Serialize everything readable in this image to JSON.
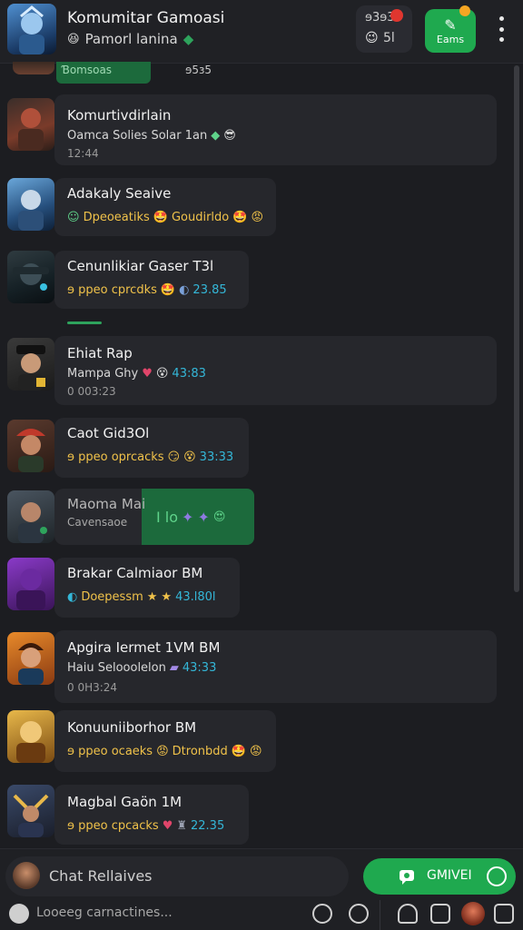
{
  "header": {
    "title": "Komumitar Gamoasi",
    "subtitle": "Pamorl lanina",
    "badge_top": "ɘ3ɘ3",
    "badge_bottom": "5l",
    "games_label": "Eams"
  },
  "partial_row": {
    "text": "Ɓomsoas",
    "text2": "ɘ5ɜ5"
  },
  "chats": [
    {
      "name": "Komurtivdirlain",
      "message": "Oamca Solies Solar 1an",
      "time": "12:44",
      "color": "w"
    },
    {
      "name": "Adakaly Seaive",
      "message": "Dpeoeatiks",
      "message2": "Goudirldo",
      "color": "y"
    },
    {
      "name": "Cenunlikiar Gaser T3l",
      "message": "ɘ ppeo cprcdks",
      "time": "23.85",
      "color": "y"
    },
    {
      "name": "Ehiat Rap",
      "message": "Mampa Ghy",
      "time": "43:83",
      "meta": "0 003:23",
      "color": "w"
    },
    {
      "name": "Caot Gid3Ol",
      "message": "ɘ ppeo oprcacks",
      "time": "33:33",
      "color": "y"
    },
    {
      "name": "Maoma Mai",
      "message": "Cavensaoe",
      "extra": "I lo",
      "color": "w"
    },
    {
      "name": "Brakar Calmiaor BM",
      "message": "Doepessm",
      "time": "43.l80l",
      "color": "y"
    },
    {
      "name": "Apgira Iermet 1VM BM",
      "message": "Haiu Selooolelon",
      "time": "43:33",
      "meta": "0 0H3:24",
      "color": "w"
    },
    {
      "name": "Konuuniiborhor BM",
      "message": "ɘ ppeo ocaeks",
      "message2": "Dtronbdd",
      "color": "y"
    },
    {
      "name": "Magbal Gaön 1M",
      "message": "ɘ ppeo cpcacks",
      "time": "22.35",
      "color": "y"
    }
  ],
  "composer": {
    "placeholder": "Chat Rellaives",
    "send_label": "GMIVEI",
    "input_hint": "Looeeg carnactines..."
  },
  "colors": {
    "accent": "#1fa94f",
    "yellow": "#f0c24a",
    "blue": "#34b7d8",
    "bg": "#1c1d21"
  }
}
